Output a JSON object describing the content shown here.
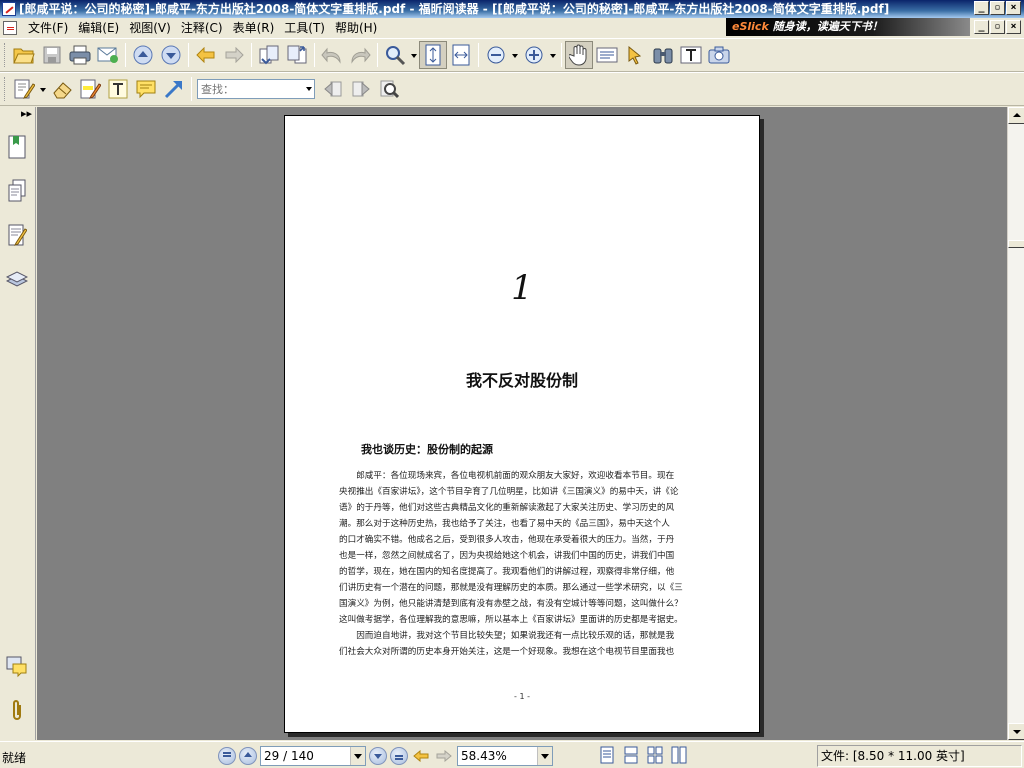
{
  "window": {
    "title": "[郎咸平说：公司的秘密]-郎咸平-东方出版社2008-简体文字重排版.pdf - 福昕阅读器 - [[郎咸平说：公司的秘密]-郎咸平-东方出版社2008-简体文字重排版.pdf]"
  },
  "banner": {
    "brand": "eSlick",
    "tagline": "随身读，读遍天下书！"
  },
  "window_buttons": {
    "minimize": "_",
    "restore": "▫",
    "close": "×"
  },
  "menu": {
    "items": [
      {
        "label": "文件(F)"
      },
      {
        "label": "编辑(E)"
      },
      {
        "label": "视图(V)"
      },
      {
        "label": "注释(C)"
      },
      {
        "label": "表单(R)"
      },
      {
        "label": "工具(T)"
      },
      {
        "label": "帮助(H)"
      }
    ]
  },
  "toolbar2": {
    "search_placeholder": "查找："
  },
  "document": {
    "chapter_number": "1",
    "chapter_title": "我不反对股份制",
    "section_title": "我也谈历史：股份制的起源",
    "lines": [
      "　　郎咸平：各位现场来宾，各位电视机前面的观众朋友大家好，欢迎收看本节目。现在",
      "央视推出《百家讲坛》，这个节目孕育了几位明星，比如讲《三国演义》的易中天，讲《论",
      "语》的于丹等，他们对这些古典精品文化的重新解读激起了大家关注历史、学习历史的风",
      "潮。那么对于这种历史热，我也给予了关注，也看了易中天的《品三国》，易中天这个人",
      "的口才确实不错。他成名之后，受到很多人攻击，他现在承受着很大的压力。当然，于丹",
      "也是一样，忽然之间就成名了，因为央视给她这个机会，讲我们中国的历史，讲我们中国",
      "的哲学，现在，她在国内的知名度提高了。我观看他们的讲解过程，观察得非常仔细，他",
      "们讲历史有一个潜在的问题，那就是没有理解历史的本质。那么通过一些学术研究，以《三",
      "国演义》为例，他只能讲清楚到底有没有赤壁之战，有没有空城计等等问题，这叫做什么？",
      "这叫做考据学，各位理解我的意思嘛，所以基本上《百家讲坛》里面讲的历史都是考据史。",
      "　　因而迫自地讲，我对这个节目比较失望；如果说我还有一点比较乐观的话，那就是我",
      "们社会大众对所谓的历史本身开始关注，这是一个好现象。我想在这个电视节目里面我也"
    ],
    "page_label": "- 1 -"
  },
  "status": {
    "ready_text": "就绪",
    "page_indicator": "29 / 140",
    "zoom": "58.43%",
    "file_size": "文件: [8.50 * 11.00 英寸]"
  }
}
